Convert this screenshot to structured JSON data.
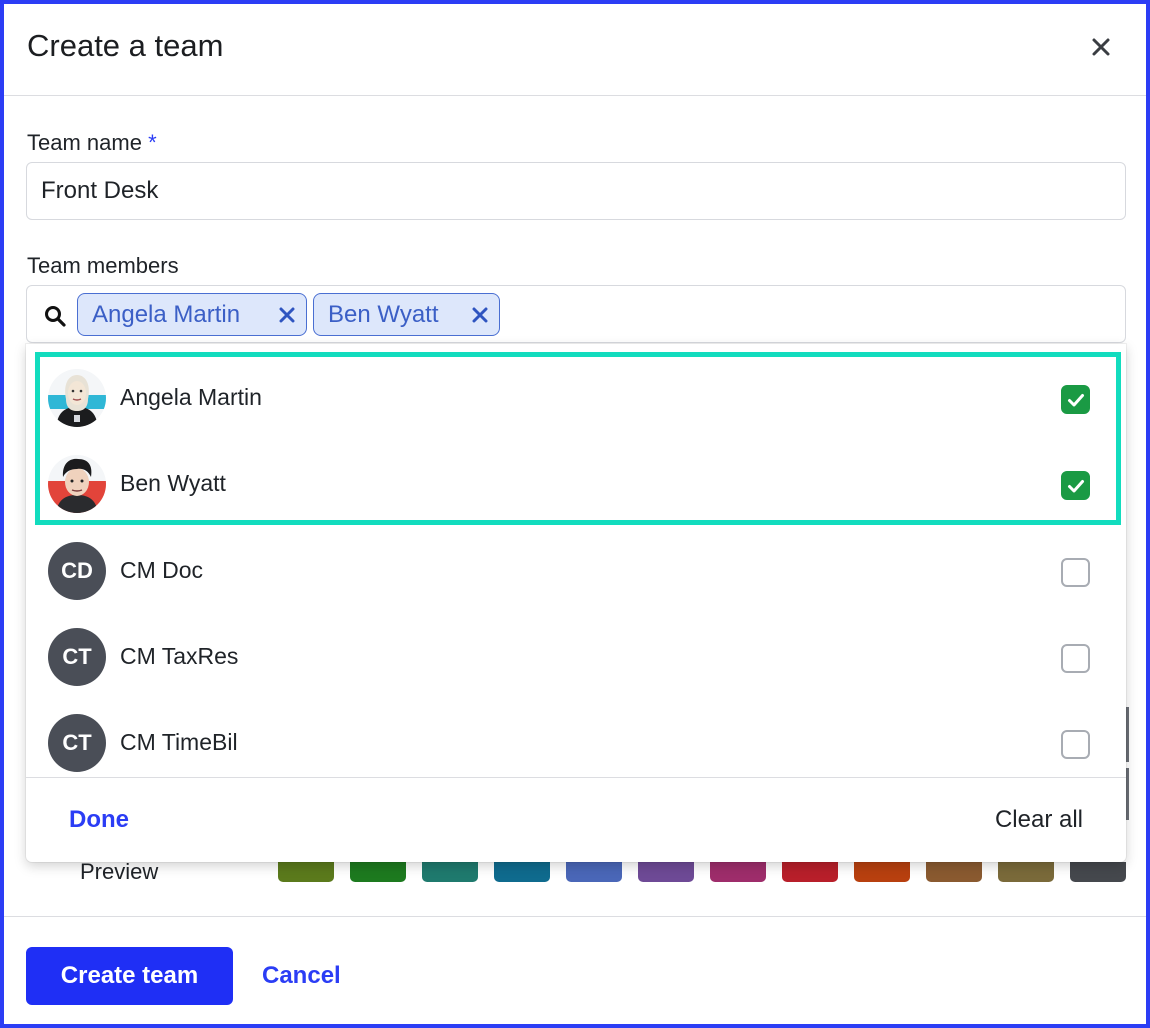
{
  "dialog": {
    "title": "Create a team",
    "close_icon": "close-icon"
  },
  "form": {
    "team_name_label": "Team name",
    "required_marker": "*",
    "team_name_value": "Front Desk",
    "members_label": "Team members",
    "selected_chips": [
      {
        "label": "Angela Martin"
      },
      {
        "label": "Ben Wyatt"
      }
    ]
  },
  "dropdown": {
    "options": [
      {
        "name": "Angela Martin",
        "avatar": "illustrated-avatar",
        "checked": true
      },
      {
        "name": "Ben Wyatt",
        "avatar": "illustrated-avatar",
        "checked": true
      },
      {
        "name": "CM Doc",
        "initials": "CD",
        "checked": false
      },
      {
        "name": "CM TaxRes",
        "initials": "CT",
        "checked": false
      },
      {
        "name": "CM TimeBil",
        "initials": "CT",
        "checked": false
      }
    ],
    "done_label": "Done",
    "clear_label": "Clear all",
    "highlight_color": "#12dcbe"
  },
  "preview": {
    "label": "Preview",
    "swatch_colors": [
      "#5b7a1c",
      "#1d7a1f",
      "#1f7a6e",
      "#0f6b8e",
      "#4a67b8",
      "#6e4a96",
      "#9e2d6b",
      "#b81f2a",
      "#b8400f",
      "#8a5a30",
      "#7a6a3a",
      "#45484d"
    ]
  },
  "footer": {
    "create_label": "Create team",
    "cancel_label": "Cancel"
  },
  "colors": {
    "accent": "#2b3df5",
    "checked": "#1a9a44",
    "chip_bg": "#dde7fb"
  }
}
